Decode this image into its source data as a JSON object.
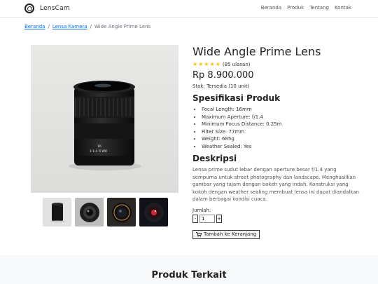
{
  "header": {
    "brand": "LensCam",
    "nav": [
      "Beranda",
      "Produk",
      "Tentang",
      "Kontak"
    ]
  },
  "breadcrumb": {
    "home": "Beranda",
    "category": "Lensa Kamera",
    "current": "Wide Angle Prime Lens",
    "separator": "/"
  },
  "product": {
    "title": "Wide Angle Prime Lens",
    "rating": 5,
    "reviews": "(85 ulasan)",
    "price": "Rp 8.900.000",
    "stock": "Stok: Tersedia (10 unit)",
    "spec_heading": "Spesifikasi Produk",
    "specs": [
      "Focal Length: 16mm",
      "Maximum Aperture: f/1.4",
      "Minimum Focus Distance: 0.25m",
      "Filter Size: 77mm",
      "Weight: 685g",
      "Weather Sealed: Yes"
    ],
    "desc_heading": "Deskripsi",
    "description": "Lensa prime sudut lebar dengan aperture besar f/1.4 yang sempurna untuk street photography dan landscape. Menghasilkan gambar yang tajam dengan bokeh yang indah. Konstruksi yang kokoh dengan weather sealing membuat lensa ini dapat diandalkan dalam berbagai kondisi cuaca.",
    "qty_label": "Jumlah:",
    "qty_minus": "-",
    "qty_plus": "+",
    "qty_value": "1",
    "cart_button": "Tambah ke Keranjang",
    "cart_icon": "cart-icon",
    "lens_text_1": "16",
    "lens_text_2": "1:1.4 R WR"
  },
  "related": {
    "title": "Produk Terkait"
  },
  "colors": {
    "link": "#0d6efd",
    "star": "#ffc107",
    "section_bg": "#f8f9fa"
  }
}
